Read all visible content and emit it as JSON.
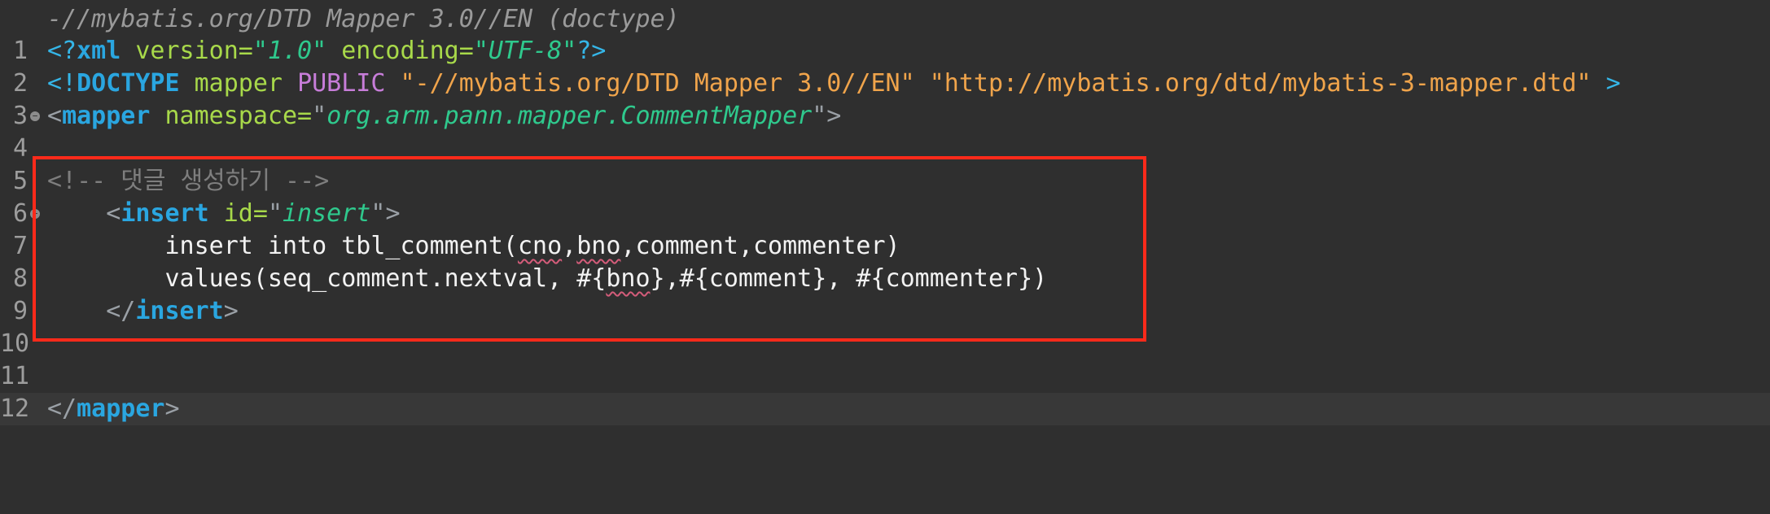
{
  "breadcrumb": "-//mybatis.org/DTD Mapper 3.0//EN (doctype)",
  "line_numbers": [
    "1",
    "2",
    "3",
    "4",
    "5",
    "6",
    "7",
    "8",
    "9",
    "10",
    "11",
    "12"
  ],
  "lines": {
    "l1": {
      "open": "<?",
      "tag": "xml",
      "attr1": " version=",
      "val1": "\"1.0\"",
      "attr2": " encoding=",
      "val2": "\"UTF-8\"",
      "close": "?>"
    },
    "l2": {
      "open": "<!",
      "kw": "DOCTYPE",
      "name": " mapper ",
      "public": "PUBLIC",
      "sp": " ",
      "str1": "\"-//mybatis.org/DTD Mapper 3.0//EN\"",
      "sp2": " ",
      "str2": "\"http://mybatis.org/dtd/mybatis-3-mapper.dtd\"",
      "close": " >"
    },
    "l3": {
      "open": "<",
      "tag": "mapper",
      "attr": " namespace=",
      "q1": "\"",
      "val": "org.arm.pann.mapper.CommentMapper",
      "q2": "\"",
      "close": ">"
    },
    "l5": {
      "comment": "<!-- 댓글 생성하기 -->"
    },
    "l6": {
      "indent": "    ",
      "open": "<",
      "tag": "insert",
      "attr": " id=",
      "q1": "\"",
      "val": "insert",
      "q2": "\"",
      "close": ">"
    },
    "l7": {
      "pre": "        insert into tbl_comment(",
      "w1": "cno",
      "comma": ",",
      "w2": "bno",
      "post": ",comment,commenter)"
    },
    "l8": {
      "pre": "        values(seq_comment.nextval, #{",
      "w1": "bno",
      "post": "},#{comment}, #{commenter})"
    },
    "l9": {
      "indent": "    ",
      "open": "</",
      "tag": "insert",
      "close": ">"
    },
    "l12": {
      "open": "</",
      "tag": "mapper",
      "close": ">"
    }
  },
  "colors": {
    "background": "#2f2f2f",
    "current_line": "#383838",
    "highlight_box": "#ff2a1a",
    "tag": "#2aa6e0",
    "attribute": "#a8d94a",
    "string": "#2fc98d",
    "dtd_string": "#f0a44b",
    "comment": "#7e7e7e"
  }
}
